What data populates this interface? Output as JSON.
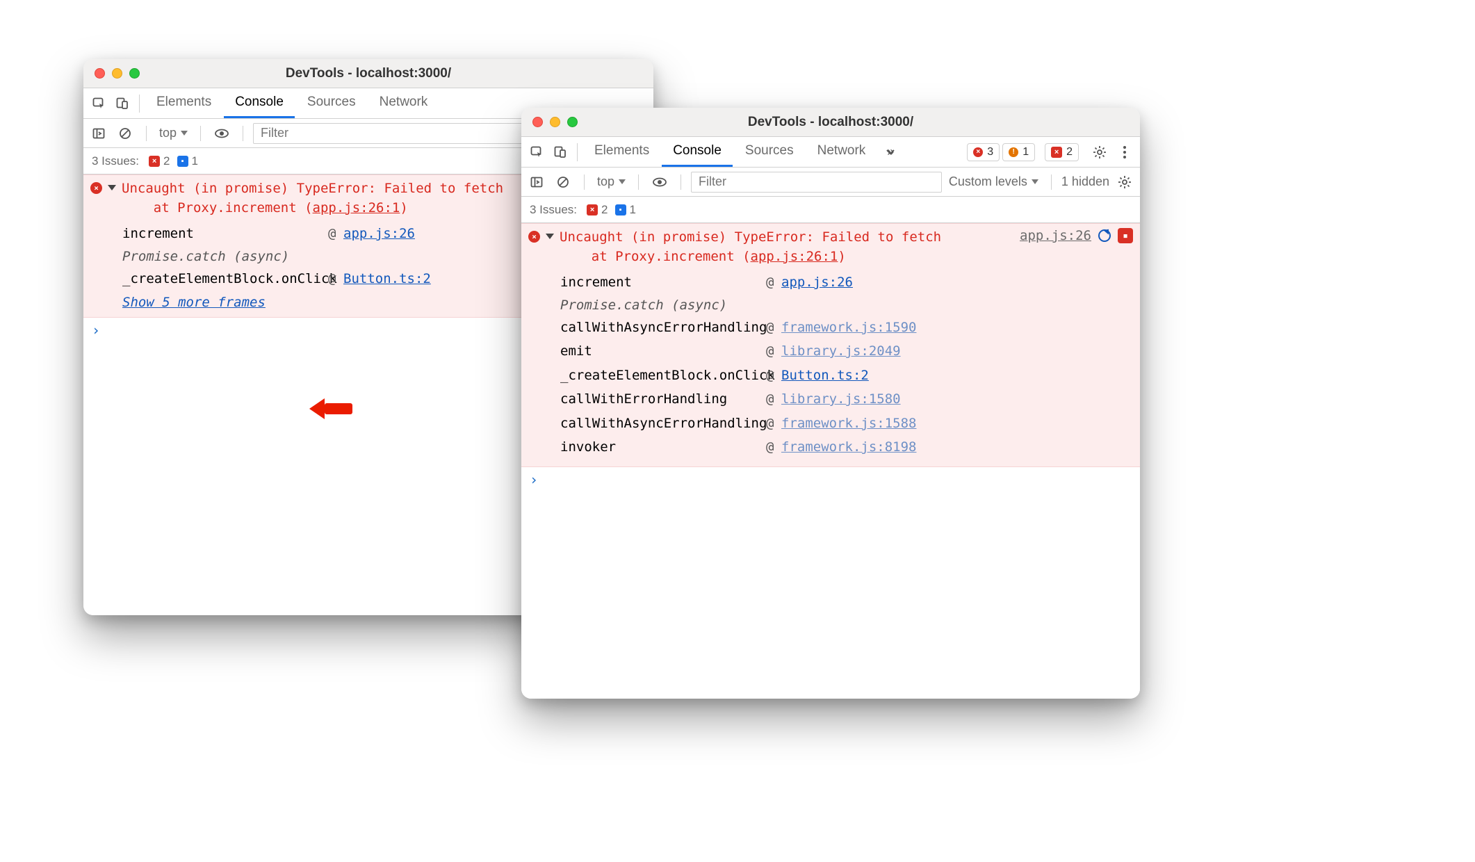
{
  "winTitle": "DevTools - localhost:3000/",
  "tabs": {
    "elements": "Elements",
    "console": "Console",
    "sources": "Sources",
    "network": "Network"
  },
  "toolbar": {
    "context": "top",
    "filter_ph": "Filter",
    "levels": "Custom levels",
    "hidden": "1 hidden"
  },
  "issues": {
    "label": "3 Issues:",
    "errors": "2",
    "info": "1"
  },
  "error": {
    "line1": "Uncaught (in promise) TypeError: Failed to fetch",
    "line2_prefix": "    at Proxy.increment (",
    "line2_src": "app.js:26:1",
    "line2_suffix": ")",
    "right_src": "app.js:26"
  },
  "win2_badges": {
    "err": "3",
    "warn": "1",
    "x": "2"
  },
  "trace1": [
    {
      "fn": "increment",
      "loc": "app.js:26",
      "muted": false
    },
    {
      "async": "Promise.catch (async)"
    },
    {
      "fn": "_createElementBlock.onClick",
      "loc": "Button.ts:2",
      "muted": false
    }
  ],
  "more_link": "Show 5 more frames",
  "trace2": [
    {
      "fn": "increment",
      "loc": "app.js:26",
      "muted": false
    },
    {
      "async": "Promise.catch (async)"
    },
    {
      "fn": "callWithAsyncErrorHandling",
      "loc": "framework.js:1590",
      "muted": true
    },
    {
      "fn": "emit",
      "loc": "library.js:2049",
      "muted": true
    },
    {
      "fn": "_createElementBlock.onClick",
      "loc": "Button.ts:2",
      "muted": false
    },
    {
      "fn": "callWithErrorHandling",
      "loc": "library.js:1580",
      "muted": true
    },
    {
      "fn": "callWithAsyncErrorHandling",
      "loc": "framework.js:1588",
      "muted": true
    },
    {
      "fn": "invoker",
      "loc": "framework.js:8198",
      "muted": true
    }
  ],
  "prompt": "›"
}
